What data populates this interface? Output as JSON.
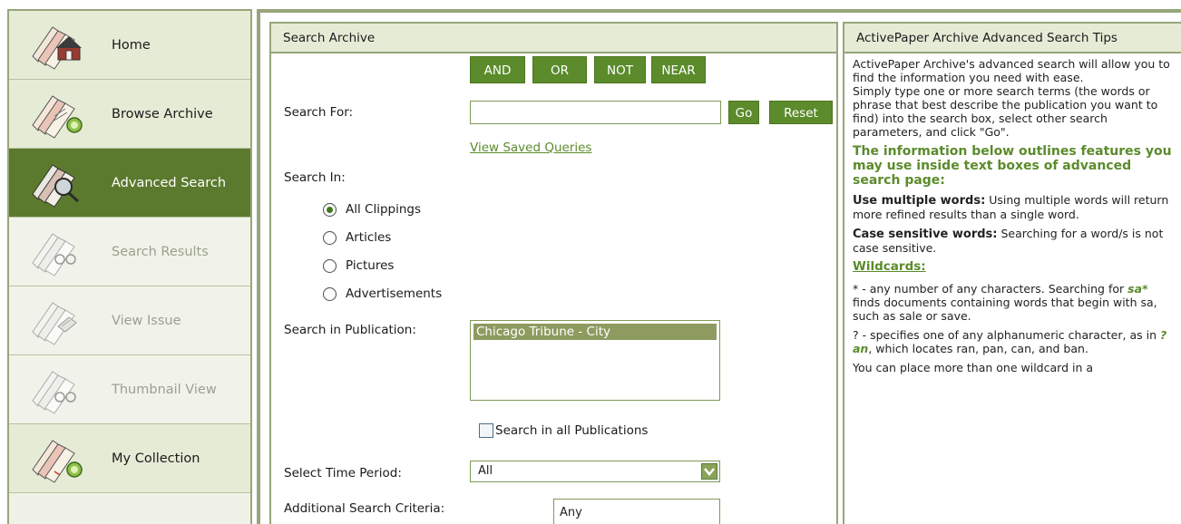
{
  "sidebar": {
    "items": [
      {
        "label": "Home",
        "state": "normal",
        "icon": "home-icon"
      },
      {
        "label": "Browse Archive",
        "state": "normal",
        "icon": "browse-icon"
      },
      {
        "label": "Advanced Search",
        "state": "active",
        "icon": "search-magnifier-icon"
      },
      {
        "label": "Search Results",
        "state": "disabled",
        "icon": "binoculars-icon"
      },
      {
        "label": "View Issue",
        "state": "disabled",
        "icon": "newspaper-icon"
      },
      {
        "label": "Thumbnail View",
        "state": "disabled",
        "icon": "binoculars-icon"
      },
      {
        "label": "My Collection",
        "state": "normal",
        "icon": "collection-icon"
      }
    ]
  },
  "search": {
    "title": "Search Archive",
    "operators": [
      "AND",
      "OR",
      "NOT",
      "NEAR"
    ],
    "search_for_label": "Search For:",
    "search_for_value": "",
    "go_label": "Go",
    "reset_label": "Reset",
    "saved_queries_link": "View Saved Queries",
    "search_in_label": "Search In:",
    "search_in_options": [
      {
        "label": "All Clippings",
        "checked": true
      },
      {
        "label": "Articles",
        "checked": false
      },
      {
        "label": "Pictures",
        "checked": false
      },
      {
        "label": "Advertisements",
        "checked": false
      }
    ],
    "publication_label": "Search in Publication:",
    "publications": [
      "Chicago Tribune - City"
    ],
    "all_publications_label": "Search in all Publications",
    "all_publications_checked": false,
    "time_period_label": "Select Time Period:",
    "time_period_value": "All",
    "additional_label": "Additional Search Criteria:",
    "additional_value": "Any"
  },
  "tips": {
    "title": "ActivePaper Archive Advanced Search Tips",
    "intro1": "ActivePaper Archive's advanced search will allow you to find the information you need with ease.",
    "intro2": "Simply type one or more search terms (the words or phrase that best describe the publication you want to find) into the search box, select other search parameters, and click \"Go\".",
    "heading": "The information below outlines features you may use inside text boxes of advanced search page:",
    "multi_bold": "Use multiple words:",
    "multi_text": " Using multiple words will return more refined results than a single word.",
    "case_bold": "Case sensitive words:",
    "case_text": " Searching for a word/s is not case sensitive.",
    "wildcards_link": "Wildcards:",
    "star_pre": "* - any number of any characters. Searching for ",
    "star_em": "sa*",
    "star_post": " finds documents containing words that begin with sa, such as sale or save.",
    "q_pre": "? - specifies one of any alphanumeric character, as in ",
    "q_em": "?an",
    "q_post": ", which locates ran, pan, can, and ban.",
    "more": "You can place more than one wildcard in a"
  },
  "colors": {
    "accent": "#5b8b2b",
    "active_nav": "#5b7a2e",
    "panel_header": "#e6ebd6",
    "border": "#97a67a"
  }
}
